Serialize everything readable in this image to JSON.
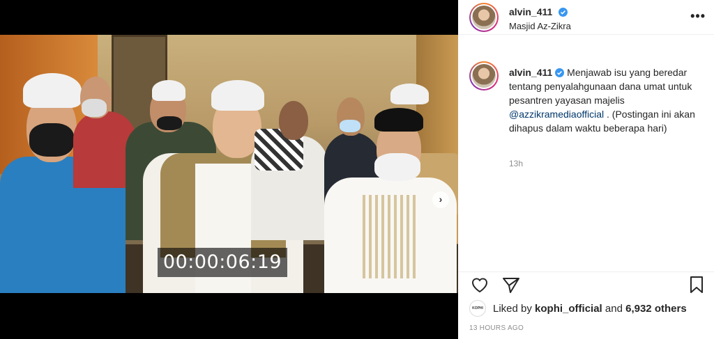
{
  "media": {
    "timecode": "00:00:06:19",
    "icons": {
      "next": "chevron-right-icon",
      "tags": "user-tag-icon",
      "sound": "speaker-icon"
    },
    "carousel_dots": 3,
    "carousel_active": 1
  },
  "header": {
    "username": "alvin_411",
    "location": "Masjid Az-Zikra",
    "more": "more-options-icon"
  },
  "comment": {
    "username": "alvin_411",
    "text_before": "Menjawab isu yang beredar tentang penyalahgunaan dana umat untuk pesantren yayasan majelis ",
    "mention": "@azzikramediaofficial",
    "text_after": " . (Postingan ini akan dihapus dalam waktu beberapa hari)",
    "time": "13h"
  },
  "likes": {
    "avatar_text": "KOPHI",
    "prefix": "Liked by ",
    "liker": "kophi_official",
    "middle": " and ",
    "others": "6,932 others"
  },
  "posted": "13 HOURS AGO",
  "colors": {
    "verified": "#3897f0",
    "mention": "#00376b",
    "muted": "#8e8e8e"
  }
}
